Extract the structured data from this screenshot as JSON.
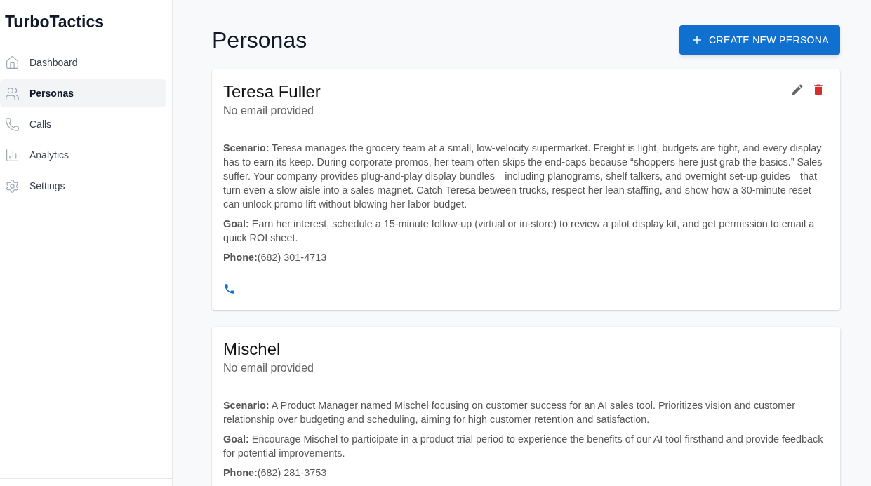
{
  "app": {
    "title": "TurboTactics"
  },
  "sidebar": {
    "items": [
      {
        "label": "Dashboard",
        "selected": false
      },
      {
        "label": "Personas",
        "selected": true
      },
      {
        "label": "Calls",
        "selected": false
      },
      {
        "label": "Analytics",
        "selected": false
      },
      {
        "label": "Settings",
        "selected": false
      }
    ]
  },
  "page": {
    "title": "Personas",
    "create_button": "CREATE NEW PERSONA"
  },
  "personas": [
    {
      "name": "Teresa Fuller",
      "email": "No email provided",
      "show_actions": true,
      "scenario": "**Scenario:** Teresa manages the grocery team at a small, low-velocity supermarket. Freight is light, budgets are tight, and every display has to earn its keep. During corporate promos, her team often skips the end-caps because “shoppers here just grab the basics.” Sales suffer. Your company provides plug-and-play display bundles—including planograms, shelf talkers, and overnight set-up guides—that turn even a slow aisle into a sales magnet. Catch Teresa between trucks, respect her lean staffing, and show how a 30-minute reset can unlock promo lift without blowing her labor budget.",
      "goal": "**Goal:** Earn her interest, schedule a 15-minute follow-up (virtual or in-store) to review a pilot display kit, and get permission to email a quick ROI sheet.",
      "phone": "**Phone:**(682) 301-4713",
      "show_call": true
    },
    {
      "name": "Mischel",
      "email": "No email provided",
      "show_actions": false,
      "scenario": "**Scenario:** A Product Manager named Mischel focusing on customer success for an AI sales tool. Prioritizes vision and customer relationship over budgeting and scheduling, aiming for high customer retention and satisfaction.",
      "goal": "**Goal:** Encourage Mischel to participate in a product trial period to experience the benefits of our AI tool firsthand and provide feedback for potential improvements.",
      "phone": "**Phone:**(682) 281-3753",
      "show_call": false
    }
  ]
}
